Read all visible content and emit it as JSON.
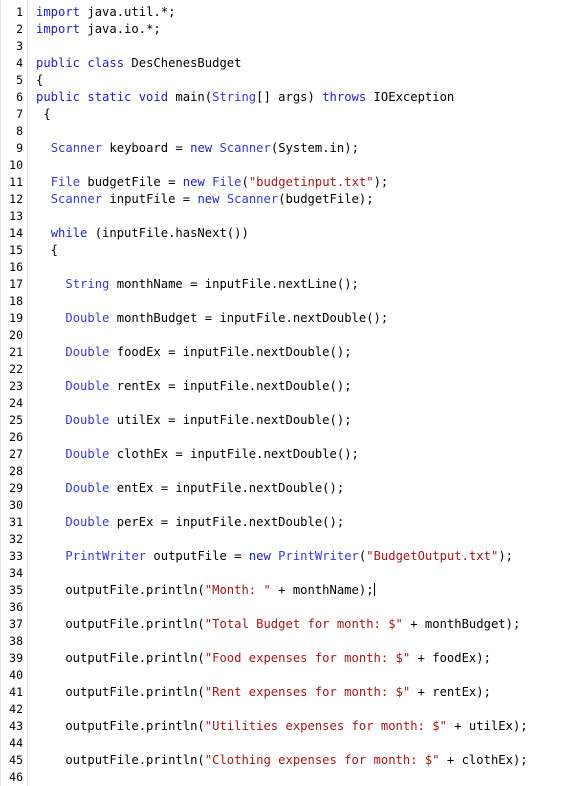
{
  "editor": {
    "language": "Java",
    "class_name": "DesChenesBudget",
    "total_visible_lines": 46,
    "first_line_number": 1,
    "last_line_number": 46,
    "caret_line": 35,
    "caret_column": 44,
    "colors": {
      "background": "#ffffff",
      "gutter_background": "#ffffff",
      "gutter_border": "#d8d8d8",
      "line_number_text": "#000000",
      "plain_text": "#000000",
      "keyword": "#2020c0",
      "type": "#3a3ac8",
      "string_literal": "#a01818",
      "caret": "#000000"
    }
  },
  "lines": [
    {
      "n": "1",
      "tokens": [
        {
          "t": "kw",
          "v": "import"
        },
        {
          "t": "pln",
          "v": " java.util.*;"
        }
      ]
    },
    {
      "n": "2",
      "tokens": [
        {
          "t": "kw",
          "v": "import"
        },
        {
          "t": "pln",
          "v": " java.io.*;"
        }
      ]
    },
    {
      "n": "3",
      "tokens": []
    },
    {
      "n": "4",
      "tokens": [
        {
          "t": "kw",
          "v": "public class"
        },
        {
          "t": "pln",
          "v": " DesChenesBudget"
        }
      ]
    },
    {
      "n": "5",
      "tokens": [
        {
          "t": "pln",
          "v": "{"
        }
      ]
    },
    {
      "n": "6",
      "tokens": [
        {
          "t": "kw",
          "v": "public static void"
        },
        {
          "t": "pln",
          "v": " main("
        },
        {
          "t": "type",
          "v": "String"
        },
        {
          "t": "pln",
          "v": "[] args) "
        },
        {
          "t": "kw",
          "v": "throws"
        },
        {
          "t": "pln",
          "v": " IOException"
        }
      ]
    },
    {
      "n": "7",
      "tokens": [
        {
          "t": "pln",
          "v": " {"
        }
      ]
    },
    {
      "n": "8",
      "tokens": []
    },
    {
      "n": "9",
      "tokens": [
        {
          "t": "pln",
          "v": "  "
        },
        {
          "t": "type",
          "v": "Scanner"
        },
        {
          "t": "pln",
          "v": " keyboard = "
        },
        {
          "t": "kw",
          "v": "new"
        },
        {
          "t": "pln",
          "v": " "
        },
        {
          "t": "type",
          "v": "Scanner"
        },
        {
          "t": "pln",
          "v": "(System.in);"
        }
      ]
    },
    {
      "n": "10",
      "tokens": []
    },
    {
      "n": "11",
      "tokens": [
        {
          "t": "pln",
          "v": "  "
        },
        {
          "t": "type",
          "v": "File"
        },
        {
          "t": "pln",
          "v": " budgetFile = "
        },
        {
          "t": "kw",
          "v": "new"
        },
        {
          "t": "pln",
          "v": " "
        },
        {
          "t": "type",
          "v": "File"
        },
        {
          "t": "pln",
          "v": "("
        },
        {
          "t": "str",
          "v": "\"budgetinput.txt\""
        },
        {
          "t": "pln",
          "v": ");"
        }
      ]
    },
    {
      "n": "12",
      "tokens": [
        {
          "t": "pln",
          "v": "  "
        },
        {
          "t": "type",
          "v": "Scanner"
        },
        {
          "t": "pln",
          "v": " inputFile = "
        },
        {
          "t": "kw",
          "v": "new"
        },
        {
          "t": "pln",
          "v": " "
        },
        {
          "t": "type",
          "v": "Scanner"
        },
        {
          "t": "pln",
          "v": "(budgetFile);"
        }
      ]
    },
    {
      "n": "13",
      "tokens": []
    },
    {
      "n": "14",
      "tokens": [
        {
          "t": "pln",
          "v": "  "
        },
        {
          "t": "kw",
          "v": "while"
        },
        {
          "t": "pln",
          "v": " (inputFile.hasNext())"
        }
      ]
    },
    {
      "n": "15",
      "tokens": [
        {
          "t": "pln",
          "v": "  {"
        }
      ]
    },
    {
      "n": "16",
      "tokens": []
    },
    {
      "n": "17",
      "tokens": [
        {
          "t": "pln",
          "v": "    "
        },
        {
          "t": "type",
          "v": "String"
        },
        {
          "t": "pln",
          "v": " monthName = inputFile.nextLine();"
        }
      ]
    },
    {
      "n": "18",
      "tokens": []
    },
    {
      "n": "19",
      "tokens": [
        {
          "t": "pln",
          "v": "    "
        },
        {
          "t": "type",
          "v": "Double"
        },
        {
          "t": "pln",
          "v": " monthBudget = inputFile.nextDouble();"
        }
      ]
    },
    {
      "n": "20",
      "tokens": []
    },
    {
      "n": "21",
      "tokens": [
        {
          "t": "pln",
          "v": "    "
        },
        {
          "t": "type",
          "v": "Double"
        },
        {
          "t": "pln",
          "v": " foodEx = inputFile.nextDouble();"
        }
      ]
    },
    {
      "n": "22",
      "tokens": []
    },
    {
      "n": "23",
      "tokens": [
        {
          "t": "pln",
          "v": "    "
        },
        {
          "t": "type",
          "v": "Double"
        },
        {
          "t": "pln",
          "v": " rentEx = inputFile.nextDouble();"
        }
      ]
    },
    {
      "n": "24",
      "tokens": []
    },
    {
      "n": "25",
      "tokens": [
        {
          "t": "pln",
          "v": "    "
        },
        {
          "t": "type",
          "v": "Double"
        },
        {
          "t": "pln",
          "v": " utilEx = inputFile.nextDouble();"
        }
      ]
    },
    {
      "n": "26",
      "tokens": []
    },
    {
      "n": "27",
      "tokens": [
        {
          "t": "pln",
          "v": "    "
        },
        {
          "t": "type",
          "v": "Double"
        },
        {
          "t": "pln",
          "v": " clothEx = inputFile.nextDouble();"
        }
      ]
    },
    {
      "n": "28",
      "tokens": []
    },
    {
      "n": "29",
      "tokens": [
        {
          "t": "pln",
          "v": "    "
        },
        {
          "t": "type",
          "v": "Double"
        },
        {
          "t": "pln",
          "v": " entEx = inputFile.nextDouble();"
        }
      ]
    },
    {
      "n": "30",
      "tokens": []
    },
    {
      "n": "31",
      "tokens": [
        {
          "t": "pln",
          "v": "    "
        },
        {
          "t": "type",
          "v": "Double"
        },
        {
          "t": "pln",
          "v": " perEx = inputFile.nextDouble();"
        }
      ]
    },
    {
      "n": "32",
      "tokens": []
    },
    {
      "n": "33",
      "tokens": [
        {
          "t": "pln",
          "v": "    "
        },
        {
          "t": "type",
          "v": "PrintWriter"
        },
        {
          "t": "pln",
          "v": " outputFile = "
        },
        {
          "t": "kw",
          "v": "new"
        },
        {
          "t": "pln",
          "v": " "
        },
        {
          "t": "type",
          "v": "PrintWriter"
        },
        {
          "t": "pln",
          "v": "("
        },
        {
          "t": "str",
          "v": "\"BudgetOutput.txt\""
        },
        {
          "t": "pln",
          "v": ");"
        }
      ]
    },
    {
      "n": "34",
      "tokens": []
    },
    {
      "n": "35",
      "tokens": [
        {
          "t": "pln",
          "v": "    outputFile.println("
        },
        {
          "t": "str",
          "v": "\"Month: \""
        },
        {
          "t": "pln",
          "v": " + monthName);"
        }
      ],
      "caret": true
    },
    {
      "n": "36",
      "tokens": []
    },
    {
      "n": "37",
      "tokens": [
        {
          "t": "pln",
          "v": "    outputFile.println("
        },
        {
          "t": "str",
          "v": "\"Total Budget for month: $\""
        },
        {
          "t": "pln",
          "v": " + monthBudget);"
        }
      ]
    },
    {
      "n": "38",
      "tokens": []
    },
    {
      "n": "39",
      "tokens": [
        {
          "t": "pln",
          "v": "    outputFile.println("
        },
        {
          "t": "str",
          "v": "\"Food expenses for month: $\""
        },
        {
          "t": "pln",
          "v": " + foodEx);"
        }
      ]
    },
    {
      "n": "40",
      "tokens": []
    },
    {
      "n": "41",
      "tokens": [
        {
          "t": "pln",
          "v": "    outputFile.println("
        },
        {
          "t": "str",
          "v": "\"Rent expenses for month: $\""
        },
        {
          "t": "pln",
          "v": " + rentEx);"
        }
      ]
    },
    {
      "n": "42",
      "tokens": []
    },
    {
      "n": "43",
      "tokens": [
        {
          "t": "pln",
          "v": "    outputFile.println("
        },
        {
          "t": "str",
          "v": "\"Utilities expenses for month: $\""
        },
        {
          "t": "pln",
          "v": " + utilEx);"
        }
      ]
    },
    {
      "n": "44",
      "tokens": []
    },
    {
      "n": "45",
      "tokens": [
        {
          "t": "pln",
          "v": "    outputFile.println("
        },
        {
          "t": "str",
          "v": "\"Clothing expenses for month: $\""
        },
        {
          "t": "pln",
          "v": " + clothEx);"
        }
      ]
    },
    {
      "n": "46",
      "tokens": []
    }
  ]
}
